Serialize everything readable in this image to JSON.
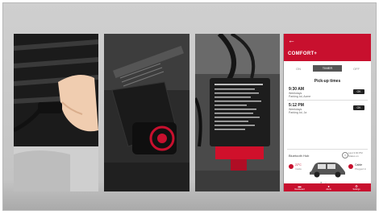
{
  "phone": {
    "back": "←",
    "title": "COMFORT+",
    "tabs": [
      "ON",
      "TIMER",
      "OFF"
    ],
    "section_title": "Pick-up times",
    "schedules": [
      {
        "time": "9:30 AM",
        "days": "Weekdays",
        "place": "Parking lot, Acme",
        "button": "OK"
      },
      {
        "time": "5:12 PM",
        "days": "Weekdays",
        "place": "Parking lot, Ja",
        "button": "OK"
      }
    ],
    "hub": {
      "title": "Bluetooth Hub",
      "status": "Last 3:00 PM",
      "status2": "Status on",
      "temp": "22°C",
      "temp_sub": "Inside",
      "cable": "Cable",
      "cable_sub": "Plugged in"
    },
    "nav": [
      {
        "label": "Dashboard",
        "glyph": "▬"
      },
      {
        "label": "Alerts",
        "glyph": "●"
      },
      {
        "label": "Settings",
        "glyph": "⚙"
      }
    ]
  },
  "colors": {
    "brand_red": "#c8102e",
    "background": "#c9c9c9"
  }
}
